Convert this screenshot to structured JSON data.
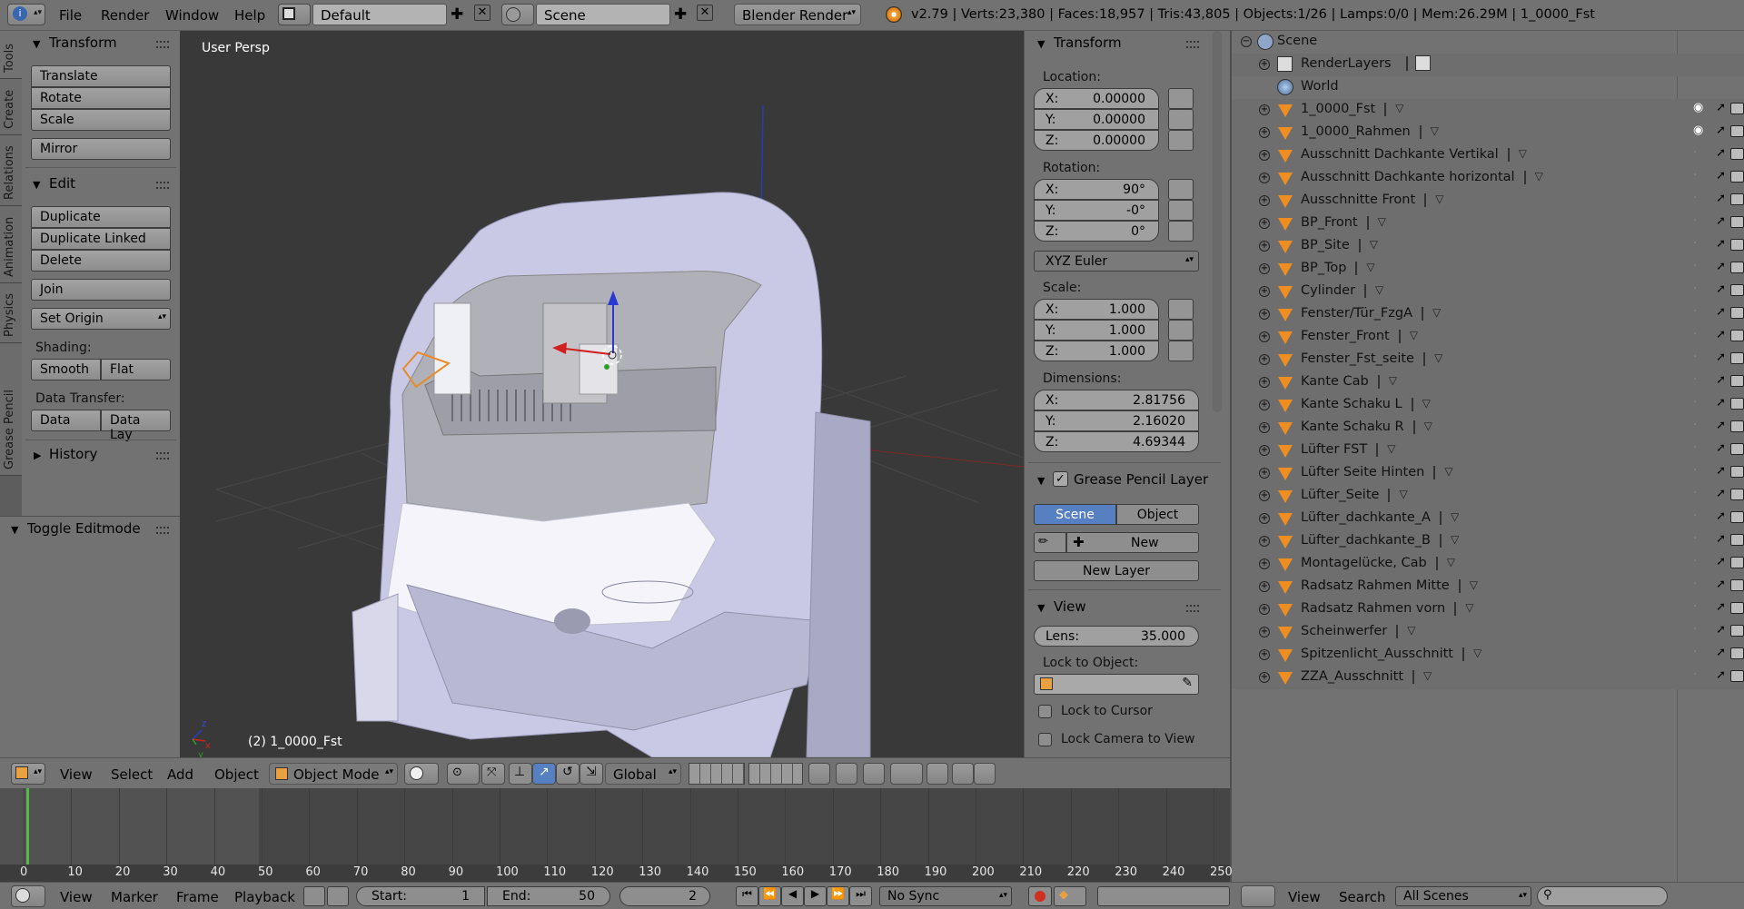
{
  "topbar": {
    "menus": [
      "File",
      "Render",
      "Window",
      "Help"
    ],
    "layout": "Default",
    "scene": "Scene",
    "engine": "Blender Render",
    "stats": "v2.79 | Verts:23,380 | Faces:18,957 | Tris:43,805 | Objects:1/26 | Lamps:0/0 | Mem:26.29M | 1_0000_Fst"
  },
  "tabs": [
    "Tools",
    "Create",
    "Relations",
    "Animation",
    "Physics",
    "Grease Pencil"
  ],
  "toolshelf": {
    "transform_title": "Transform",
    "translate": "Translate",
    "rotate": "Rotate",
    "scale": "Scale",
    "mirror": "Mirror",
    "edit_title": "Edit",
    "duplicate": "Duplicate",
    "duplicate_linked": "Duplicate Linked",
    "delete": "Delete",
    "join": "Join",
    "set_origin": "Set Origin",
    "shading_label": "Shading:",
    "smooth": "Smooth",
    "flat": "Flat",
    "data_transfer_label": "Data Transfer:",
    "data": "Data",
    "data_lay": "Data Lay",
    "history": "History",
    "toggle_editmode": "Toggle Editmode"
  },
  "viewport": {
    "view_name": "User Persp",
    "object_label": "(2) 1_0000_Fst"
  },
  "props": {
    "transform_title": "Transform",
    "location_label": "Location:",
    "location": {
      "x": "0.00000",
      "y": "0.00000",
      "z": "0.00000"
    },
    "rotation_label": "Rotation:",
    "rotation": {
      "x": "90°",
      "y": "-0°",
      "z": "0°"
    },
    "rotation_mode": "XYZ Euler",
    "scale_label": "Scale:",
    "scale": {
      "x": "1.000",
      "y": "1.000",
      "z": "1.000"
    },
    "dimensions_label": "Dimensions:",
    "dimensions": {
      "x": "2.81756",
      "y": "2.16020",
      "z": "4.69344"
    },
    "axis_x": "X:",
    "axis_y": "Y:",
    "axis_z": "Z:",
    "grease_title": "Grease Pencil Layer",
    "gp_scene": "Scene",
    "gp_object": "Object",
    "gp_new": "New",
    "gp_new_layer": "New Layer",
    "view_title": "View",
    "lens_label": "Lens:",
    "lens_value": "35.000",
    "lock_to_object": "Lock to Object:",
    "lock_to_cursor": "Lock to Cursor",
    "lock_camera": "Lock Camera to View"
  },
  "outliner": {
    "scene": "Scene",
    "render_layers": "RenderLayers",
    "world": "World",
    "objects": [
      "1_0000_Fst",
      "1_0000_Rahmen",
      "Ausschnitt Dachkante Vertikal",
      "Ausschnitt Dachkante horizontal",
      "Ausschnitte Front",
      "BP_Front",
      "BP_Site",
      "BP_Top",
      "Cylinder",
      "Fenster/Tür_FzgA",
      "Fenster_Front",
      "Fenster_Fst_seite",
      "Kante Cab",
      "Kante Schaku L",
      "Kante Schaku R",
      "Lüfter FST",
      "Lüfter Seite Hinten",
      "Lüfter_Seite",
      "Lüfter_dachkante_A",
      "Lüfter_dachkante_B",
      "Montagelücke, Cab",
      "Radsatz Rahmen Mitte",
      "Radsatz Rahmen vorn",
      "Scheinwerfer",
      "Spitzenlicht_Ausschnitt",
      "ZZA_Ausschnitt"
    ],
    "view": "View",
    "search": "Search",
    "all_scenes": "All Scenes"
  },
  "vp_header": {
    "view": "View",
    "select": "Select",
    "add": "Add",
    "object": "Object",
    "mode": "Object Mode",
    "orientation": "Global"
  },
  "timeline": {
    "ticks": [
      "0",
      "10",
      "20",
      "30",
      "40",
      "50",
      "60",
      "70",
      "80",
      "90",
      "100",
      "110",
      "120",
      "130",
      "140",
      "150",
      "160",
      "170",
      "180",
      "190",
      "200",
      "210",
      "220",
      "230",
      "240",
      "250"
    ],
    "view": "View",
    "marker": "Marker",
    "frame": "Frame",
    "playback": "Playback",
    "start_label": "Start:",
    "start": "1",
    "end_label": "End:",
    "end": "50",
    "current": "2",
    "sync": "No Sync"
  },
  "colors": {
    "accent": "#5680c2",
    "mesh_icon": "#ee8d20",
    "viewport_bg": "#393939"
  }
}
